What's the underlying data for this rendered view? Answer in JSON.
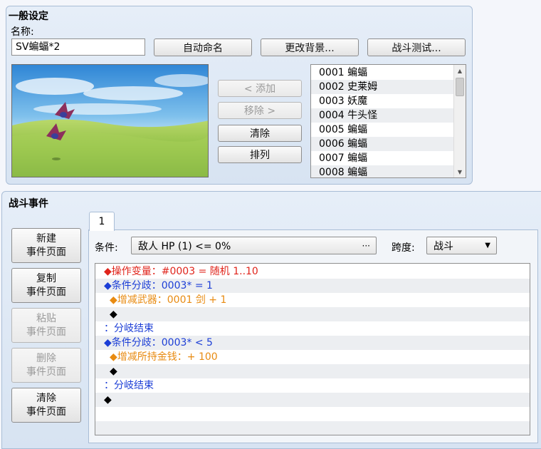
{
  "general": {
    "title": "一般设定",
    "name_label": "名称:",
    "name_value": "SV蝙蝠*2",
    "auto_name_button": "自动命名",
    "change_bg_button": "更改背景...",
    "battle_test_button": "战斗测试...",
    "add_button": "< 添加",
    "remove_button": "移除 >",
    "clear_button": "清除",
    "arrange_button": "排列",
    "enemies": [
      "0001 蝙蝠",
      "0002 史莱姆",
      "0003 妖魔",
      "0004 牛头怪",
      "0005 蝙蝠",
      "0006 蝙蝠",
      "0007 蝙蝠",
      "0008 蝙蝠"
    ]
  },
  "battle_events": {
    "title": "战斗事件",
    "new_page_button": [
      "新建",
      "事件页面"
    ],
    "copy_page_button": [
      "复制",
      "事件页面"
    ],
    "paste_page_button": [
      "粘贴",
      "事件页面"
    ],
    "delete_page_button": [
      "删除",
      "事件页面"
    ],
    "clear_page_button": [
      "清除",
      "事件页面"
    ],
    "tab_label": "1",
    "condition_label": "条件:",
    "condition_value": "敌人 HP (1) <= 0%",
    "condition_more": "···",
    "span_label": "跨度:",
    "span_value": "战斗",
    "commands": [
      {
        "text": "◆操作变量：#0003 = 随机 1..10",
        "color": "red",
        "indent": 0
      },
      {
        "text": "◆条件分歧：0003* = 1",
        "color": "blue",
        "indent": 0
      },
      {
        "text": "◆增减武器：0001 剑 + 1",
        "color": "orange",
        "indent": 1
      },
      {
        "text": "◆",
        "color": "black",
        "indent": 1
      },
      {
        "text": "：分岐结束",
        "color": "blue",
        "indent": 0
      },
      {
        "text": "◆条件分歧：0003* < 5",
        "color": "blue",
        "indent": 0
      },
      {
        "text": "◆增减所持金钱：+ 100",
        "color": "orange",
        "indent": 1
      },
      {
        "text": "◆",
        "color": "black",
        "indent": 1
      },
      {
        "text": "：分岐结束",
        "color": "blue",
        "indent": 0
      },
      {
        "text": "◆",
        "color": "black",
        "indent": 0
      },
      {
        "text": "",
        "color": "black",
        "indent": 0
      },
      {
        "text": "",
        "color": "black",
        "indent": 0
      }
    ]
  },
  "colors": {
    "red": "#e0241b",
    "blue": "#1c3ed6",
    "orange": "#e88b12",
    "black": "#000000"
  }
}
